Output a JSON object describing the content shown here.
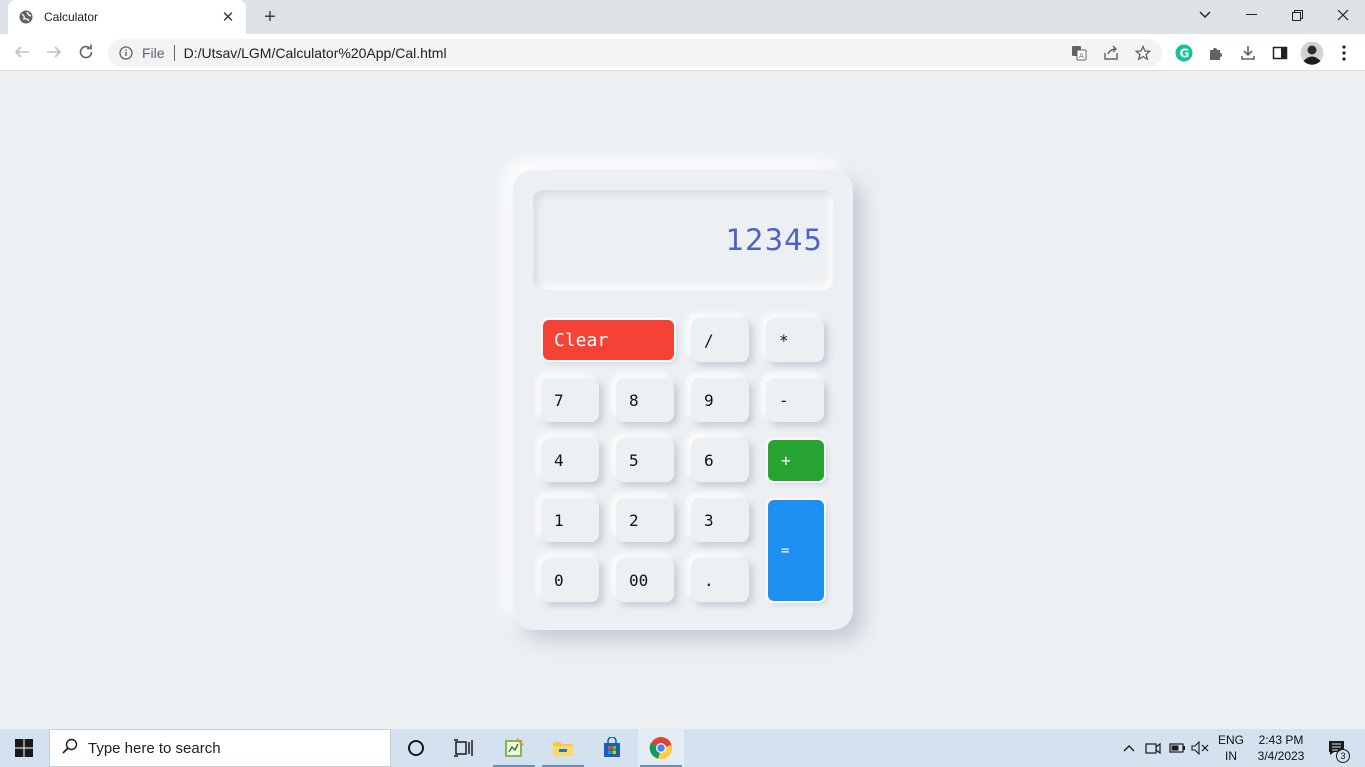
{
  "browser": {
    "tab_title": "Calculator",
    "tab_close": "✕",
    "new_tab": "+",
    "url_scheme": "File",
    "url": "D:/Utsav/LGM/Calculator%20App/Cal.html"
  },
  "calculator": {
    "display_value": "12345",
    "keys": {
      "clear": "Clear",
      "divide": "/",
      "multiply": "*",
      "seven": "7",
      "eight": "8",
      "nine": "9",
      "minus": "-",
      "four": "4",
      "five": "5",
      "six": "6",
      "plus": "+",
      "one": "1",
      "two": "2",
      "three": "3",
      "equals": "=",
      "zero": "0",
      "double_zero": "00",
      "decimal": "."
    },
    "colors": {
      "clear": "#f44336",
      "plus": "#27a332",
      "equals": "#1e90f2",
      "display_text": "#4c62c7",
      "background": "#ecf0f3"
    }
  },
  "taskbar": {
    "search_placeholder": "Type here to search",
    "language": "ENG",
    "region": "IN",
    "time": "2:43 PM",
    "date": "3/4/2023",
    "notification_count": "3"
  }
}
